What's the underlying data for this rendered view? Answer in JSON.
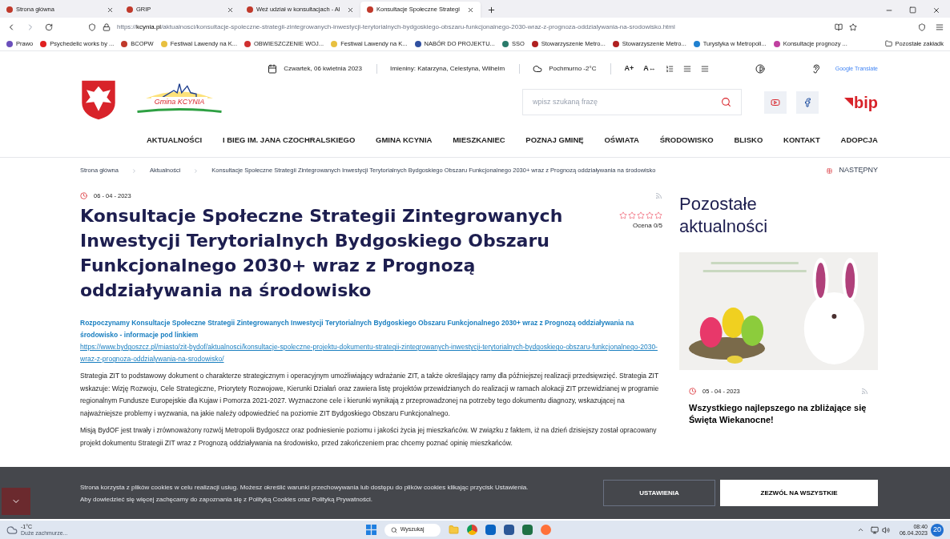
{
  "browser": {
    "tabs": [
      {
        "title": "Strona główna",
        "selected": false
      },
      {
        "title": "GRIP",
        "selected": false
      },
      {
        "title": "Weź udział w konsultacjach - Al",
        "selected": false
      },
      {
        "title": "Konsultacje Społeczne Strategi",
        "selected": true
      }
    ],
    "url_scheme": "https://",
    "url_domain": "kcynia.pl",
    "url_path": "/aktualnosci/konsultacje-spoleczne-strategii-zintegrowanych-inwestycji-terytorialnych-bydgoskiego-obszaru-funkcjonalnego-2030-wraz-z-prognoza-oddzialywania-na-srodowisko.html",
    "bookmarks": [
      {
        "title": "Prawo",
        "color": "#6b4fbb"
      },
      {
        "title": "Psychedelic works by ...",
        "color": "#e02020"
      },
      {
        "title": "BCOPW",
        "color": "#c0392b"
      },
      {
        "title": "Festiwal Lawendy na K...",
        "color": "#e8c040"
      },
      {
        "title": "OBWIESZCZENIE WOJ...",
        "color": "#d03030"
      },
      {
        "title": "Festiwal Lawendy na K...",
        "color": "#e8c040"
      },
      {
        "title": "NABÓR DO PROJEKTU...",
        "color": "#3050a0"
      },
      {
        "title": "SSO",
        "color": "#2a7a6a"
      },
      {
        "title": "Stowarzyszenie Metro...",
        "color": "#b02020"
      },
      {
        "title": "Stowarzyszenie Metro...",
        "color": "#b02020"
      },
      {
        "title": "Turystyka w Metropoli...",
        "color": "#2080d0"
      },
      {
        "title": "Konsultacje prognozy ...",
        "color": "#c040a0"
      }
    ],
    "other_bookmarks": "Pozostałe zakładk"
  },
  "header": {
    "date": "Czwartek, 06 kwietnia 2023",
    "namedays": "Imieniny: Katarzyna, Celestyna, Wilhelm",
    "weather": "Pochmurno -2°C",
    "font_controls": [
      "A+",
      "A↔"
    ],
    "translate": "Google Translate",
    "logo_text": "Gmina KCYNIA",
    "search_placeholder": "wpisz szukaną frazę",
    "bip": "bip"
  },
  "nav": [
    "AKTUALNOŚCI",
    "I BIEG IM. JANA CZOCHRALSKIEGO",
    "GMINA KCYNIA",
    "MIESZKANIEC",
    "POZNAJ GMINĘ",
    "OŚWIATA",
    "ŚRODOWISKO",
    "BLISKO",
    "KONTAKT",
    "ADOPCJA"
  ],
  "breadcrumb": [
    "Strona główna",
    "Aktualności",
    "Konsultacje Społeczne Strategii Zintegrowanych Inwestycji Terytorialnych Bydgoskiego Obszaru Funkcjonalnego 2030+ wraz z Prognozą oddziaływania na środowisko"
  ],
  "next": "NASTĘPNY",
  "article": {
    "date": "06 - 04 - 2023",
    "title": "Konsultacje Społeczne Strategii Zintegrowanych Inwestycji Terytorialnych Bydgoskiego Obszaru Funkcjonalnego 2030+ wraz z Prognozą oddziaływania na środowisko",
    "rating": {
      "stars": 0,
      "label": "Ocena 0/5"
    },
    "lead": "Rozpoczynamy Konsultacje Społeczne Strategii Zintegrowanych Inwestycji Terytorialnych Bydgoskiego Obszaru Funkcjonalnego 2030+ wraz z Prognozą oddziaływania na środowisko - informacje pod linkiem",
    "link": "https://www.bydgoszcz.pl/miasto/zit-bydof/aktualnosci/konsultacje-spoleczne-projektu-dokumentu-strategii-zintegrowanych-inwestycji-terytorialnych-bydgoskiego-obszaru-funkcjonalnego-2030-wraz-z-prognoza-oddzialywania-na-srodowisko/",
    "paragraphs": [
      "Strategia ZIT to podstawowy dokument o charakterze strategicznym i operacyjnym umożliwiający wdrażanie ZIT, a także określający ramy dla późniejszej realizacji przedsięwzięć. Strategia ZIT wskazuje: Wizję Rozwoju, Cele Strategiczne, Priorytety Rozwojowe, Kierunki Działań oraz zawiera listę projektów przewidzianych do realizacji w ramach alokacji ZIT przewidzianej w programie regionalnym Fundusze Europejskie dla Kujaw i Pomorza 2021-2027. Wyznaczone cele i kierunki wynikają z przeprowadzonej na potrzeby tego dokumentu diagnozy, wskazującej na najważniejsze problemy i wyzwania, na jakie należy odpowiedzieć na poziomie ZIT Bydgoskiego Obszaru Funkcjonalnego.",
      "Misją BydOF jest trwały i zrównoważony rozwój Metropolii Bydgoszcz oraz podniesienie poziomu i jakości życia jej mieszkańców. W związku z faktem, iż na dzień dzisiejszy został opracowany projekt dokumentu Strategii ZIT wraz z Prognozą oddziaływania na środowisko, przed zakończeniem prac chcemy poznać opinię mieszkańców."
    ]
  },
  "sidebar": {
    "heading": "Pozostałe aktualności",
    "news": {
      "kind": "picture",
      "date": "05 - 04 - 2023",
      "title": "Wszystkiego najlepszego na zbliżające się Święta Wiekanocne!"
    }
  },
  "cookies": {
    "lines": [
      "Strona korzysta z plików cookies w celu realizacji usług. Możesz określić warunki przechowywania lub dostępu do plików cookies klikając przycisk Ustawienia.",
      "Aby dowiedzieć się więcej zachęcamy do zapoznania się z Polityką Cookies oraz Polityką Prywatności."
    ],
    "settings": "USTAWIENIA",
    "accept": "ZEZWÓL NA WSZYSTKIE"
  },
  "taskbar": {
    "temp": "-1°C",
    "weather": "Duże zachmurze...",
    "search": "Wyszukaj",
    "time": "08:40",
    "date": "06.04.2023",
    "badge": "20"
  }
}
